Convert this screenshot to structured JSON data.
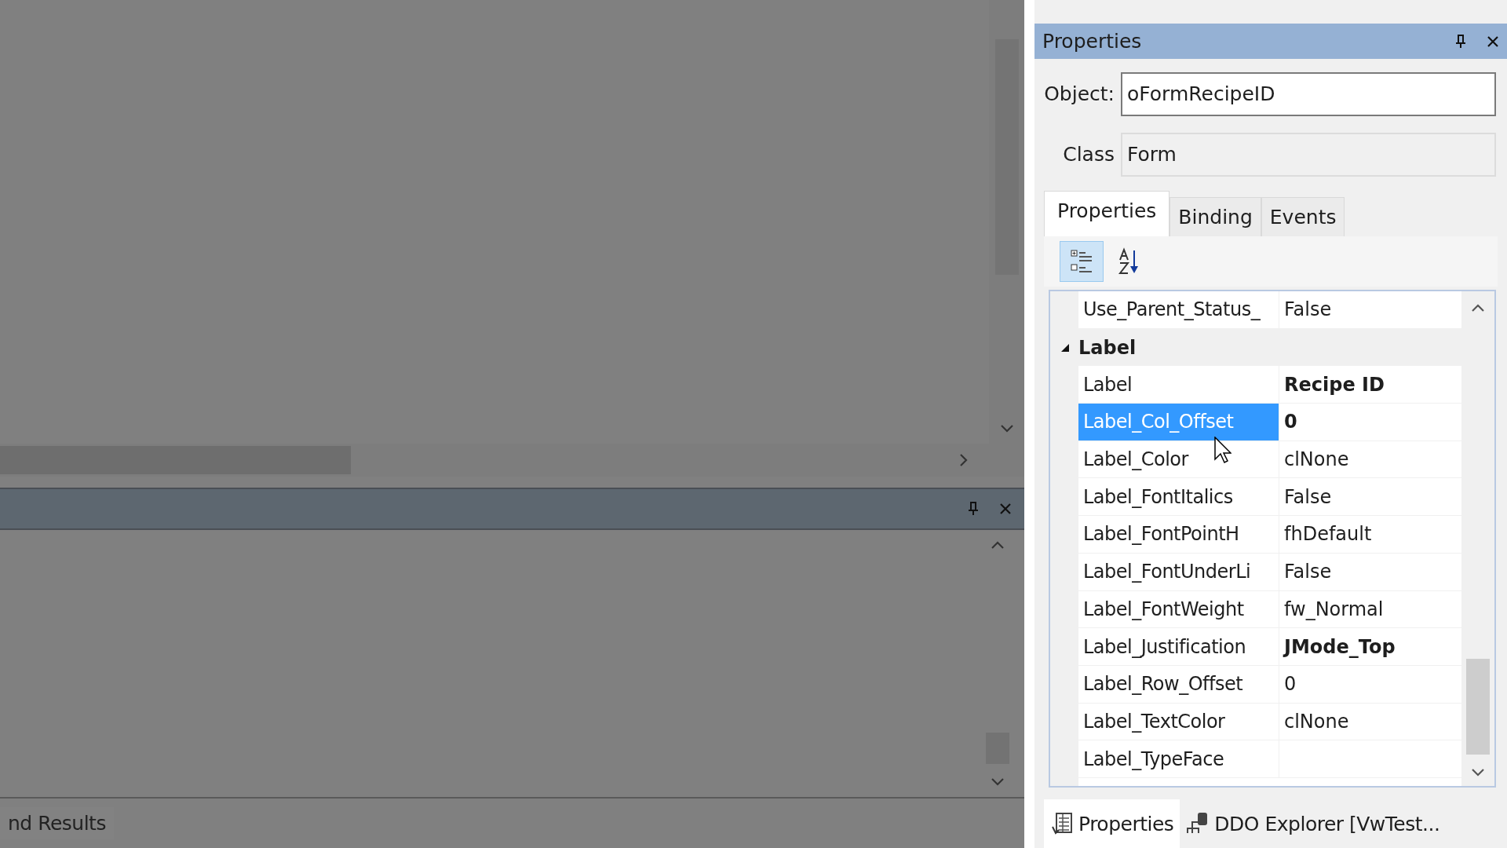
{
  "workspace": {
    "bottom_tabs": [
      {
        "label": "nd Results",
        "selected": false
      }
    ]
  },
  "properties_panel": {
    "title": "Properties",
    "object": {
      "label": "Object:",
      "value": "oFormRecipeID"
    },
    "class": {
      "label": "Class",
      "value": "Form"
    },
    "tabs": [
      {
        "label": "Properties",
        "selected": true
      },
      {
        "label": "Binding",
        "selected": false
      },
      {
        "label": "Events",
        "selected": false
      }
    ],
    "toolbar": [
      {
        "kind": "categorized",
        "selected": true
      },
      {
        "kind": "alphabetical",
        "selected": false
      }
    ],
    "grid": [
      {
        "kind": "property",
        "name": "Use_Parent_Status_",
        "value": "False",
        "modified": false,
        "selected": false
      },
      {
        "kind": "category",
        "name": "Label",
        "expanded": true
      },
      {
        "kind": "property",
        "name": "Label",
        "value": "Recipe ID",
        "modified": true,
        "selected": false
      },
      {
        "kind": "property",
        "name": "Label_Col_Offset",
        "value": "0",
        "modified": true,
        "selected": true
      },
      {
        "kind": "property",
        "name": "Label_Color",
        "value": "clNone",
        "modified": false,
        "selected": false
      },
      {
        "kind": "property",
        "name": "Label_FontItalics",
        "value": "False",
        "modified": false,
        "selected": false
      },
      {
        "kind": "property",
        "name": "Label_FontPointH",
        "value": "fhDefault",
        "modified": false,
        "selected": false
      },
      {
        "kind": "property",
        "name": "Label_FontUnderLi",
        "value": "False",
        "modified": false,
        "selected": false
      },
      {
        "kind": "property",
        "name": "Label_FontWeight",
        "value": "fw_Normal",
        "modified": false,
        "selected": false
      },
      {
        "kind": "property",
        "name": "Label_Justification",
        "value": "JMode_Top",
        "modified": true,
        "selected": false
      },
      {
        "kind": "property",
        "name": "Label_Row_Offset",
        "value": "0",
        "modified": false,
        "selected": false
      },
      {
        "kind": "property",
        "name": "Label_TextColor",
        "value": "clNone",
        "modified": false,
        "selected": false
      },
      {
        "kind": "property",
        "name": "Label_TypeFace",
        "selected": false
      }
    ],
    "bottom_tabs": [
      {
        "kind": "properties",
        "label": "Properties",
        "selected": true
      },
      {
        "kind": "explorer",
        "label": "DDO Explorer [VwTest...",
        "selected": false
      }
    ]
  }
}
